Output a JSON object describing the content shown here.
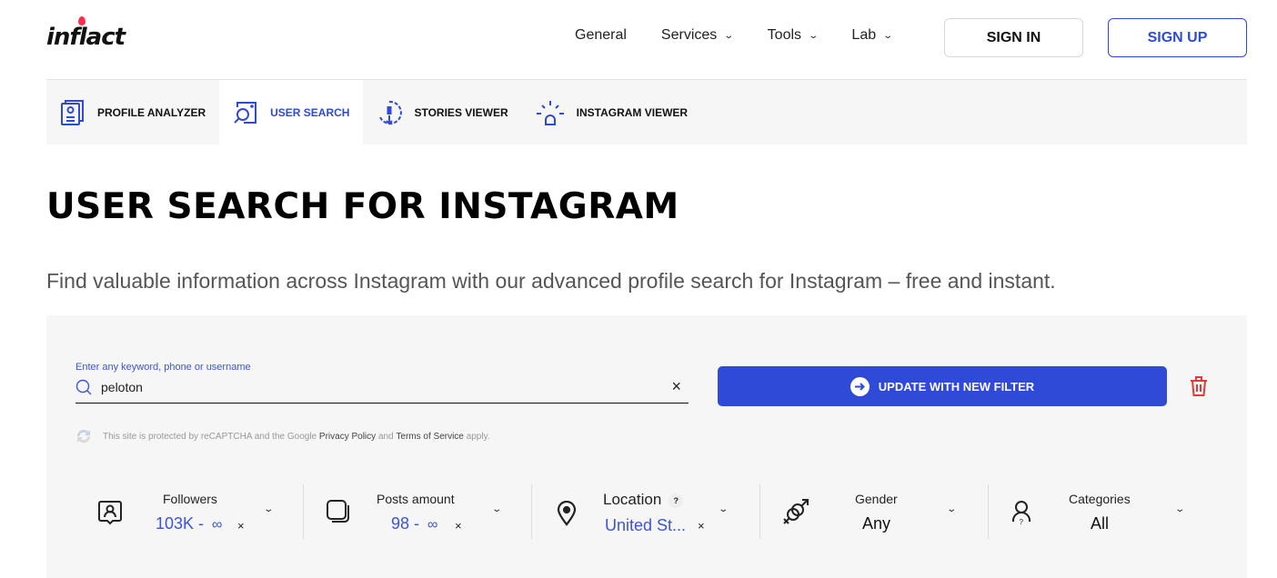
{
  "header": {
    "logo_text": "inflact",
    "nav": [
      {
        "label": "General",
        "has_dropdown": false
      },
      {
        "label": "Services",
        "has_dropdown": true
      },
      {
        "label": "Tools",
        "has_dropdown": true
      },
      {
        "label": "Lab",
        "has_dropdown": true
      }
    ],
    "sign_in": "SIGN IN",
    "sign_up": "SIGN UP"
  },
  "tabs": [
    {
      "label": "PROFILE ANALYZER",
      "icon": "profile-card-icon",
      "active": false
    },
    {
      "label": "USER SEARCH",
      "icon": "user-search-icon",
      "active": true
    },
    {
      "label": "STORIES VIEWER",
      "icon": "story-download-icon",
      "active": false
    },
    {
      "label": "INSTAGRAM VIEWER",
      "icon": "spy-light-icon",
      "active": false
    }
  ],
  "page": {
    "title": "USER SEARCH FOR INSTAGRAM",
    "subtitle": "Find valuable information across Instagram with our advanced profile search for Instagram – free and instant."
  },
  "search": {
    "label": "Enter any keyword, phone or username",
    "value": "peloton",
    "clear": "×",
    "update_button": "UPDATE WITH NEW FILTER",
    "recaptcha": {
      "prefix": "This site is protected by reCAPTCHA and the Google",
      "privacy": "Privacy Policy",
      "and": "and",
      "terms": "Terms of Service",
      "suffix": "apply."
    }
  },
  "filters": [
    {
      "label": "Followers",
      "value": "103K - ",
      "infinity": "∞",
      "clear": "×",
      "icon": "followers-icon"
    },
    {
      "label": "Posts amount",
      "value": "98 - ",
      "infinity": "∞",
      "clear": "×",
      "icon": "posts-icon"
    },
    {
      "label": "Location",
      "help": "?",
      "value": "United St...",
      "clear": "×",
      "icon": "location-pin-icon"
    },
    {
      "label": "Gender",
      "value": "Any",
      "icon": "gender-icon"
    },
    {
      "label": "Categories",
      "value": "All",
      "icon": "category-user-icon"
    }
  ],
  "colors": {
    "accent": "#2e4ad6",
    "logo_drop": "#ff2e4f",
    "trash": "#e53935",
    "panel_bg": "#f6f6f6"
  }
}
